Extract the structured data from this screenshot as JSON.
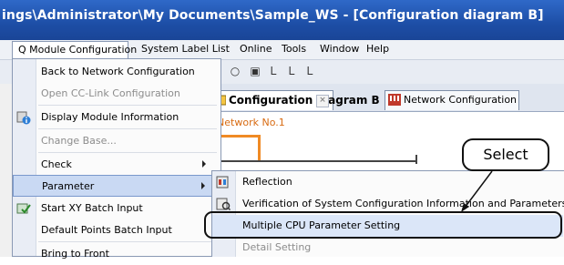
{
  "window": {
    "title": "ings\\Administrator\\My Documents\\Sample_WS - [Configuration diagram B]"
  },
  "menubar": {
    "items": [
      {
        "label": "Q Module Configuration"
      },
      {
        "label": "System Label List"
      },
      {
        "label": "Online"
      },
      {
        "label": "Tools"
      },
      {
        "label": "Window"
      },
      {
        "label": "Help"
      }
    ]
  },
  "toolbar": {
    "icons": [
      "circle-icon",
      "square-dot-icon",
      "ladder-in-icon",
      "ladder-set-icon",
      "ladder-b-icon"
    ],
    "glyphs": [
      "○",
      "▣",
      "Ｌ",
      "Ｌ",
      "Ｌ"
    ]
  },
  "tabs": [
    {
      "label": "Configuration diagram B",
      "active": true,
      "close": "×"
    },
    {
      "label": "Network Configuration",
      "active": false
    }
  ],
  "content": {
    "network_label": "ype) Network No.1"
  },
  "dropdown": {
    "items": [
      {
        "label": "Back to Network Configuration",
        "disabled": false,
        "submenu": false
      },
      {
        "label": "Open CC-Link Configuration",
        "disabled": true,
        "submenu": false
      },
      {
        "label": "Display Module Information",
        "disabled": false,
        "submenu": false
      },
      {
        "label": "Change Base...",
        "disabled": true,
        "submenu": false
      },
      {
        "label": "Check",
        "disabled": false,
        "submenu": true
      },
      {
        "label": "Parameter",
        "disabled": false,
        "submenu": true,
        "highlighted": true
      },
      {
        "label": "Start XY Batch Input",
        "disabled": false,
        "submenu": false
      },
      {
        "label": "Default Points Batch Input",
        "disabled": false,
        "submenu": false
      },
      {
        "label": "Bring to Front",
        "disabled": false,
        "submenu": false
      }
    ]
  },
  "submenu": {
    "items": [
      {
        "label": "Reflection",
        "disabled": false
      },
      {
        "label": "Verification of System Configuration Information and Parameters",
        "disabled": false
      },
      {
        "label": "Multiple CPU Parameter Setting",
        "disabled": false,
        "highlighted": true
      },
      {
        "label": "Detail Setting",
        "disabled": true
      }
    ]
  },
  "callout": {
    "text": "Select"
  },
  "colors": {
    "titlebar": "#1d4ea6",
    "accent_orange": "#f08a24",
    "menu_highlight": "#c9d9f3"
  }
}
